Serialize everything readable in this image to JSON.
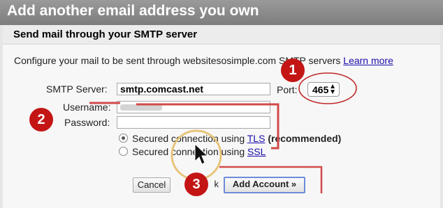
{
  "window": {
    "title": "Add another email address you own"
  },
  "section": {
    "heading": "Send mail through your SMTP server"
  },
  "description": {
    "text": "Configure your mail to be sent through websitesosimple.com SMTP servers ",
    "learn_more": "Learn more"
  },
  "form": {
    "smtp_label": "SMTP Server:",
    "smtp_value": "smtp.comcast.net",
    "port_label": "Port:",
    "port_value": "465",
    "username_label": "Username:",
    "password_label": "Password:"
  },
  "security": {
    "tls_prefix": "Secured connection using ",
    "tls_link": "TLS",
    "tls_suffix": " (recommended)",
    "ssl_prefix": "Secured connection using ",
    "ssl_link": "SSL",
    "selected": "TLS"
  },
  "buttons": {
    "cancel": "Cancel",
    "back_fragment": "k",
    "add_account": "Add Account »"
  },
  "annotations": {
    "badge_1": "1",
    "badge_2": "2",
    "badge_3": "3",
    "badge_color": "#c41515",
    "marker_color": "#d24a4a",
    "highlight_color": "#e8c47a"
  }
}
